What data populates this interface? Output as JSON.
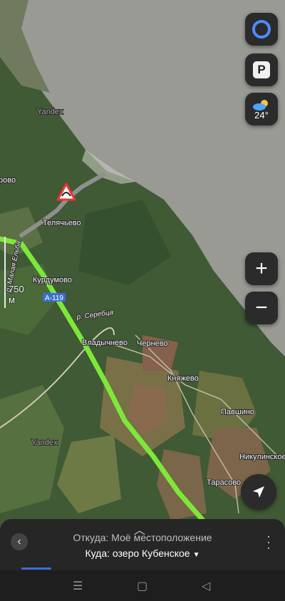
{
  "map": {
    "watermarks": [
      "Yandex",
      "Yandex"
    ],
    "places": [
      {
        "id": "telyachevo",
        "name": "Телячьево"
      },
      {
        "id": "kurdumovo",
        "name": "Курдумово"
      },
      {
        "id": "vladychnevo",
        "name": "Владычнево"
      },
      {
        "id": "chernevo",
        "name": "Чернево"
      },
      {
        "id": "knyazhevo",
        "name": "Княжево"
      },
      {
        "id": "pavshino",
        "name": "Павшино"
      },
      {
        "id": "nikulinskoe",
        "name": "Никулинское"
      },
      {
        "id": "tarasovo",
        "name": "Тарасово"
      },
      {
        "id": "edge",
        "name": "рово"
      }
    ],
    "rivers": {
      "sertsa": "р. Серебца",
      "malaya_elba": "р. Малая Ельба"
    },
    "road_label": "А-119"
  },
  "controls": {
    "alice_icon": "alice-icon",
    "parking_label": "P",
    "weather_icon": "partly-cloudy-icon",
    "weather_temp": "24°",
    "zoom_in": "+",
    "zoom_out": "−",
    "locate_icon": "navigation-arrow-icon"
  },
  "scale": {
    "label": "750 м"
  },
  "route_panel": {
    "from": "Откуда: Моё местоположение",
    "to": "Куда: озеро Кубенское",
    "to_caret": "▼"
  },
  "colors": {
    "route": "#7de83a",
    "lake": "#9a9a95",
    "forest": "#3d5b35",
    "panel": "#262626"
  },
  "system_nav": {
    "menu": "☰",
    "home": "▢",
    "back": "◁"
  }
}
